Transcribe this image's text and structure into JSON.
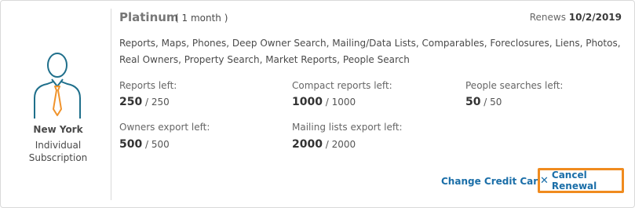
{
  "subscription": {
    "location": "New York",
    "type_line1": "Individual",
    "type_line2": "Subscription",
    "plan_name": "Platinum",
    "period": "( 1 month )",
    "renews_label": "Renews",
    "renews_date": "10/2/2019",
    "features": "Reports, Maps, Phones, Deep Owner Search, Mailing/Data Lists, Comparables, Foreclosures, Liens, Photos, Real Owners, Property Search, Market Reports, People Search"
  },
  "stats": {
    "reports": {
      "label": "Reports left:",
      "value": "250",
      "total": " / 250"
    },
    "compact": {
      "label": "Compact reports left:",
      "value": "1000",
      "total": " / 1000"
    },
    "people": {
      "label": "People searches left:",
      "value": "50",
      "total": " / 50"
    },
    "owners": {
      "label": "Owners export left:",
      "value": "500",
      "total": " / 500"
    },
    "mailing": {
      "label": "Mailing lists export left:",
      "value": "2000",
      "total": " / 2000"
    }
  },
  "actions": {
    "change_card": "Change Credit Card",
    "cancel_renewal": "Cancel Renewal"
  },
  "icons": {
    "avatar": "user-tie-icon",
    "cancel": "close-icon"
  },
  "colors": {
    "accent": "#1a6ea8",
    "highlight": "#f08b1f",
    "avatar_outline": "#1f6f8b",
    "tie": "#f0932b"
  }
}
